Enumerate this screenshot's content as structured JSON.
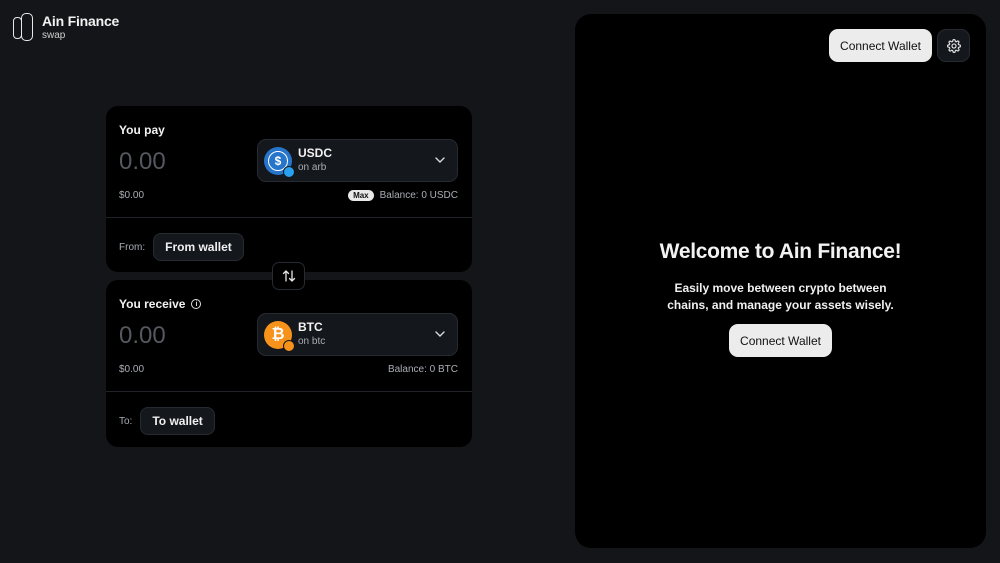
{
  "brand": {
    "name": "Ain Finance",
    "subtitle": "swap"
  },
  "pay": {
    "label": "You pay",
    "amount_placeholder": "0.00",
    "token": {
      "symbol": "USDC",
      "chain": "on arb",
      "icon": "usdc-icon",
      "color": "#2775ca"
    },
    "usd_value": "$0.00",
    "max_label": "Max",
    "balance": "Balance: 0 USDC",
    "from_label": "From:",
    "wallet_button": "From wallet"
  },
  "receive": {
    "label": "You receive",
    "amount_placeholder": "0.00",
    "token": {
      "symbol": "BTC",
      "chain": "on btc",
      "icon": "btc-icon",
      "color": "#f7931a"
    },
    "usd_value": "$0.00",
    "balance": "Balance: 0 BTC",
    "to_label": "To:",
    "wallet_button": "To wallet"
  },
  "panel": {
    "connect_wallet_top": "Connect Wallet",
    "welcome_title": "Welcome to Ain Finance!",
    "welcome_subtitle": "Easily move between crypto between chains, and manage your assets wisely.",
    "connect_wallet_center": "Connect Wallet"
  },
  "colors": {
    "background": "#141519",
    "card": "#000000",
    "button_light": "#ececec"
  }
}
